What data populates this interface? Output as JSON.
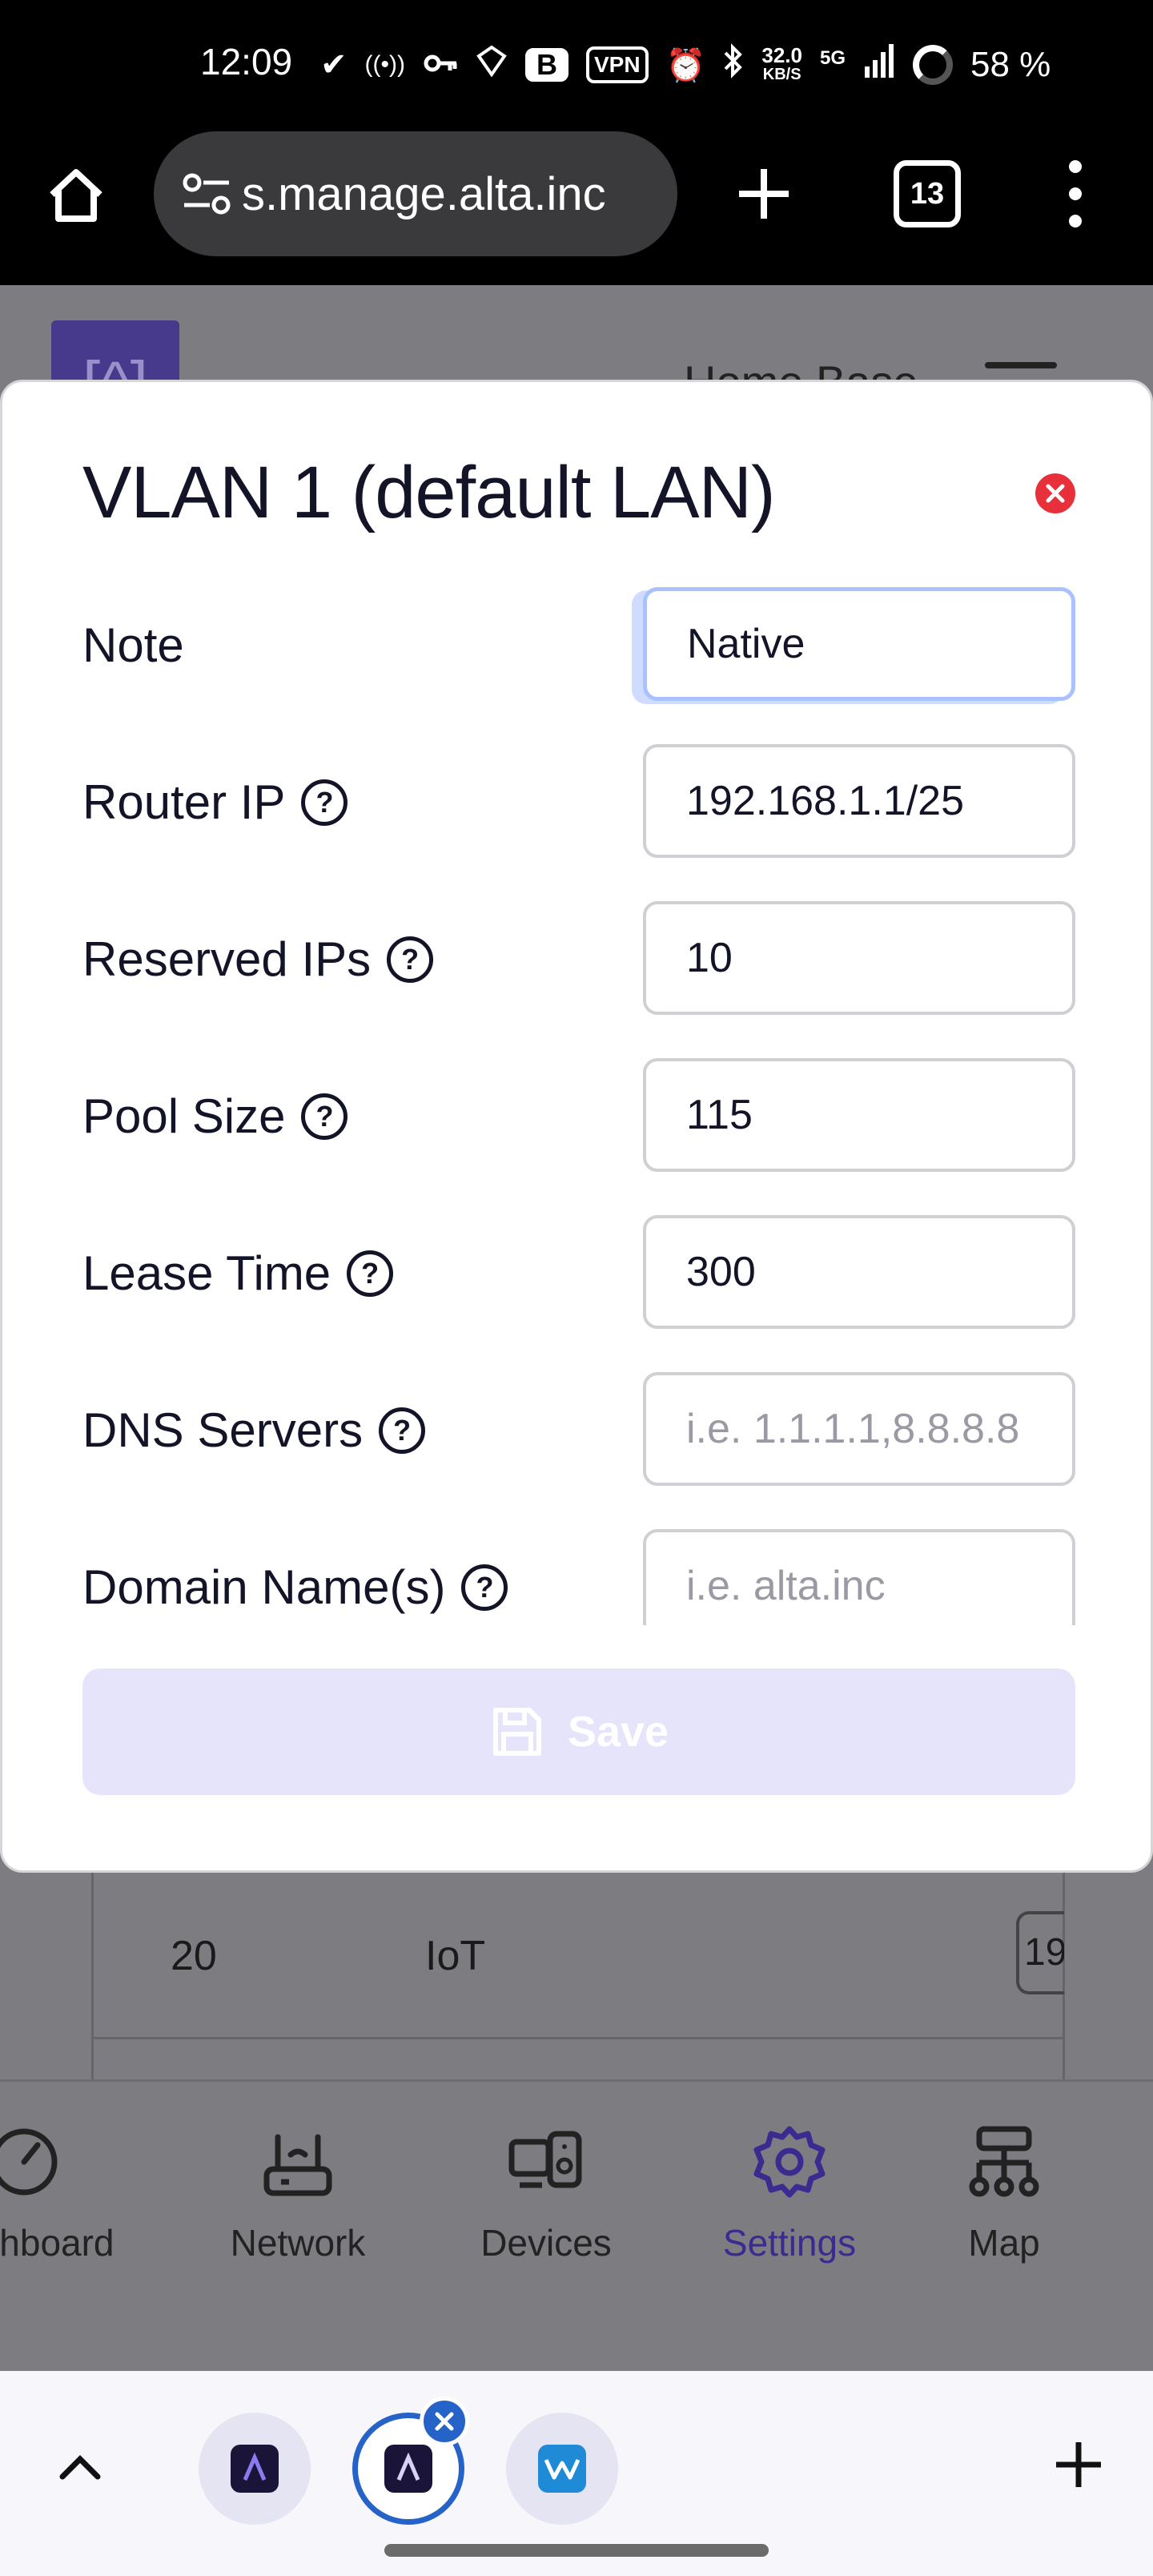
{
  "status_bar": {
    "time": "12:09",
    "vpn": "VPN",
    "b": "B",
    "net_speed_value": "32.0",
    "net_speed_unit": "KB/S",
    "network": "5G",
    "battery": "58 %"
  },
  "browser": {
    "url": "s.manage.alta.inc",
    "tab_count": "13"
  },
  "background_page": {
    "title": "Home Base",
    "table_row": {
      "id": "20",
      "name": "IoT",
      "ip": "19"
    }
  },
  "modal": {
    "title": "VLAN 1 (default LAN)",
    "fields": [
      {
        "label": "Note",
        "value": "Native",
        "placeholder": ""
      },
      {
        "label": "Router IP",
        "value": "192.168.1.1/25",
        "placeholder": ""
      },
      {
        "label": "Reserved IPs",
        "value": "10",
        "placeholder": ""
      },
      {
        "label": "Pool Size",
        "value": "115",
        "placeholder": ""
      },
      {
        "label": "Lease Time",
        "value": "300",
        "placeholder": ""
      },
      {
        "label": "DNS Servers",
        "value": "",
        "placeholder": "i.e. 1.1.1.1,8.8.8.8"
      },
      {
        "label": "Domain Name(s)",
        "value": "",
        "placeholder": "i.e. alta.inc"
      }
    ],
    "save_label": "Save"
  },
  "app_nav": {
    "items": [
      {
        "label": "Dashboard"
      },
      {
        "label": "Network"
      },
      {
        "label": "Devices"
      },
      {
        "label": "Settings",
        "active": true
      },
      {
        "label": "Map"
      }
    ],
    "active_color": "#3b2a8f"
  },
  "colors": {
    "close_button": "#e8303b",
    "save_button_disabled": "#e6e4fb",
    "tab_active_ring": "#2563c9"
  }
}
